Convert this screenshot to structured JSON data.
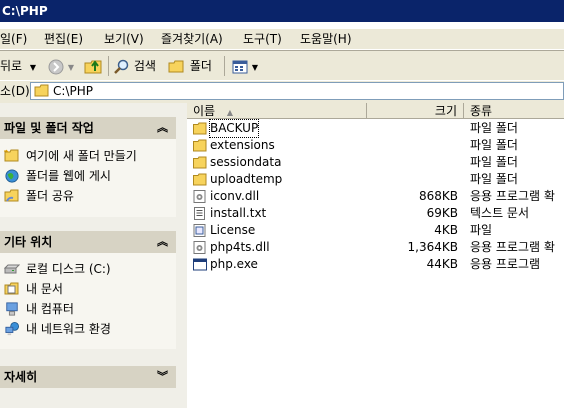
{
  "window": {
    "title": "C:\\PHP"
  },
  "menu": [
    "일(F)",
    "편집(E)",
    "보기(V)",
    "즐겨찾기(A)",
    "도구(T)",
    "도움말(H)"
  ],
  "toolbar": {
    "back": "뒤로",
    "search": "검색",
    "folders": "폴더"
  },
  "address": {
    "label": "소(D)",
    "value": "C:\\PHP"
  },
  "taskpane": {
    "file_tasks": {
      "title": "파일 및 폴더 작업",
      "items": [
        "여기에 새 폴더 만들기",
        "폴더를 웹에 게시",
        "폴더 공유"
      ]
    },
    "other_places": {
      "title": "기타 위치",
      "items": [
        "로컬 디스크 (C:)",
        "내 문서",
        "내 컴퓨터",
        "내 네트워크 환경"
      ]
    },
    "details": {
      "title": "자세히"
    }
  },
  "filelist": {
    "columns": {
      "name": "이름",
      "size": "크기",
      "type": "종류"
    },
    "rows": [
      {
        "name": "BACKUP",
        "size": "",
        "type": "파일 폴더",
        "icon": "folder-icon"
      },
      {
        "name": "extensions",
        "size": "",
        "type": "파일 폴더",
        "icon": "folder-icon"
      },
      {
        "name": "sessiondata",
        "size": "",
        "type": "파일 폴더",
        "icon": "folder-icon"
      },
      {
        "name": "uploadtemp",
        "size": "",
        "type": "파일 폴더",
        "icon": "folder-icon"
      },
      {
        "name": "iconv.dll",
        "size": "868KB",
        "type": "응용 프로그램 확",
        "icon": "dll-icon"
      },
      {
        "name": "install.txt",
        "size": "69KB",
        "type": "텍스트 문서",
        "icon": "text-file-icon"
      },
      {
        "name": "License",
        "size": "4KB",
        "type": "파일",
        "icon": "file-icon"
      },
      {
        "name": "php4ts.dll",
        "size": "1,364KB",
        "type": "응용 프로그램 확",
        "icon": "dll-icon"
      },
      {
        "name": "php.exe",
        "size": "44KB",
        "type": "응용 프로그램",
        "icon": "exe-icon"
      }
    ]
  }
}
